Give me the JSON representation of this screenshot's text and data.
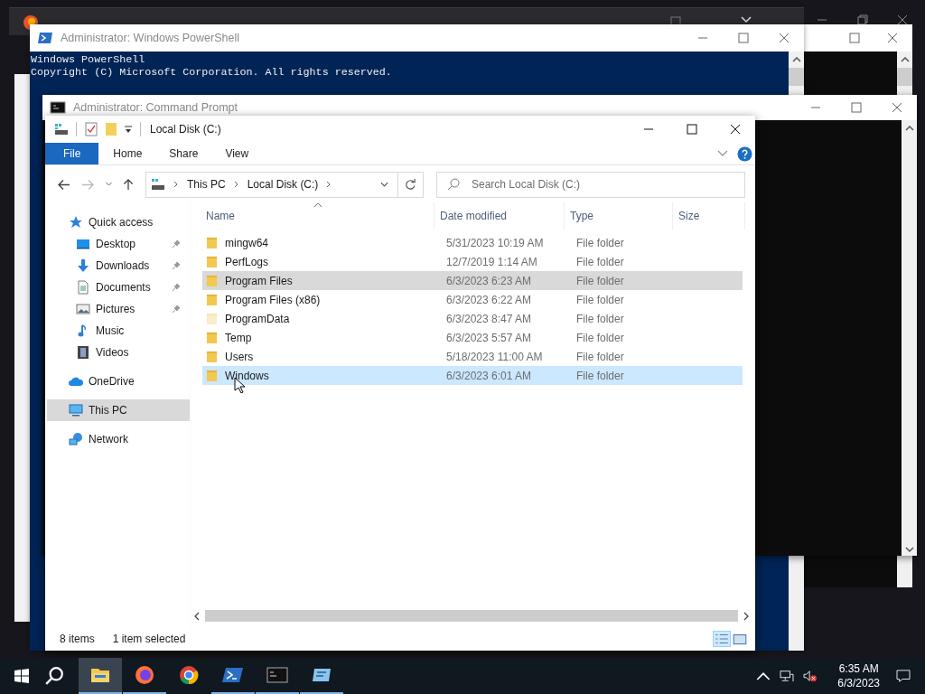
{
  "powershell": {
    "title": "Administrator: Windows PowerShell",
    "lines": [
      "Windows PowerShell",
      "Copyright (C) Microsoft Corporation. All rights reserved."
    ]
  },
  "command_prompt": {
    "title": "Administrator: Command Prompt"
  },
  "explorer": {
    "title": "Local Disk (C:)",
    "ribbon_tabs": [
      {
        "label": "File",
        "selected": true
      },
      {
        "label": "Home",
        "selected": false
      },
      {
        "label": "Share",
        "selected": false
      },
      {
        "label": "View",
        "selected": false
      }
    ],
    "breadcrumb": [
      "This PC",
      "Local Disk (C:)"
    ],
    "search": {
      "placeholder": "Search Local Disk (C:)"
    },
    "nav": [
      {
        "label": "Quick access",
        "kind": "star",
        "selected": false,
        "children": [
          {
            "label": "Desktop",
            "kind": "desktop",
            "pinned": true,
            "selected": false
          },
          {
            "label": "Downloads",
            "kind": "download",
            "pinned": true,
            "selected": false
          },
          {
            "label": "Documents",
            "kind": "document",
            "pinned": true,
            "selected": false
          },
          {
            "label": "Pictures",
            "kind": "pictures",
            "pinned": true,
            "selected": false
          },
          {
            "label": "Music",
            "kind": "music",
            "pinned": false,
            "selected": false
          },
          {
            "label": "Videos",
            "kind": "videos",
            "pinned": false,
            "selected": false
          }
        ]
      },
      {
        "label": "OneDrive",
        "kind": "cloud",
        "selected": false
      },
      {
        "label": "This PC",
        "kind": "pc",
        "selected": true
      },
      {
        "label": "Network",
        "kind": "network",
        "selected": false
      }
    ],
    "columns": [
      "Name",
      "Date modified",
      "Type",
      "Size"
    ],
    "rows": [
      {
        "name": "mingw64",
        "date": "5/31/2023 10:19 AM",
        "type": "File folder",
        "selected": false,
        "hover": false,
        "hidden": false
      },
      {
        "name": "PerfLogs",
        "date": "12/7/2019 1:14 AM",
        "type": "File folder",
        "selected": false,
        "hover": false,
        "hidden": false
      },
      {
        "name": "Program Files",
        "date": "6/3/2023 6:23 AM",
        "type": "File folder",
        "selected": false,
        "hover": true,
        "hidden": false
      },
      {
        "name": "Program Files (x86)",
        "date": "6/3/2023 6:22 AM",
        "type": "File folder",
        "selected": false,
        "hover": false,
        "hidden": false
      },
      {
        "name": "ProgramData",
        "date": "6/3/2023 8:47 AM",
        "type": "File folder",
        "selected": false,
        "hover": false,
        "hidden": true
      },
      {
        "name": "Temp",
        "date": "6/3/2023 5:57 AM",
        "type": "File folder",
        "selected": false,
        "hover": false,
        "hidden": false
      },
      {
        "name": "Users",
        "date": "5/18/2023 11:00 AM",
        "type": "File folder",
        "selected": false,
        "hover": false,
        "hidden": false
      },
      {
        "name": "Windows",
        "date": "6/3/2023 6:01 AM",
        "type": "File folder",
        "selected": true,
        "hover": false,
        "hidden": false
      }
    ],
    "status": {
      "count": "8 items",
      "selection": "1 item selected"
    }
  },
  "taskbar": {
    "apps": [
      {
        "kind": "explorer",
        "active": true,
        "running": true
      },
      {
        "kind": "firefox",
        "active": false,
        "running": true
      },
      {
        "kind": "chrome",
        "active": false,
        "running": false
      },
      {
        "kind": "powershell",
        "active": false,
        "running": true
      },
      {
        "kind": "cmd",
        "active": false,
        "running": true
      },
      {
        "kind": "terminal",
        "active": false,
        "running": true
      }
    ],
    "time": "6:35 AM",
    "date": "6/3/2023"
  }
}
